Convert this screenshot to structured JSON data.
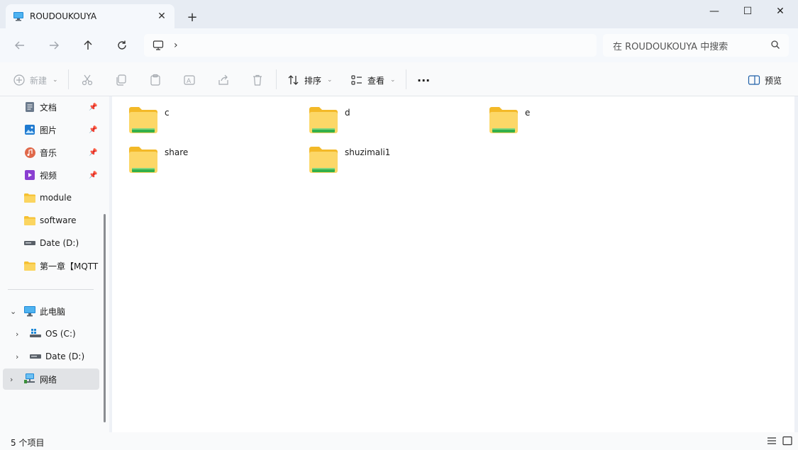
{
  "window": {
    "tab_title": "ROUDOUKOUYA",
    "tab_close": "✕",
    "new_tab": "+",
    "minimize": "—",
    "maximize": "☐",
    "close": "✕"
  },
  "nav": {
    "back_icon": "arrow-left-icon",
    "forward_icon": "arrow-right-icon",
    "up_icon": "arrow-up-icon",
    "refresh_icon": "refresh-icon",
    "address_chevron": "›",
    "search_placeholder": "在 ROUDOUKOUYA 中搜索"
  },
  "commands": {
    "new_label": "新建",
    "sort_label": "排序",
    "view_label": "查看",
    "more_label": "···",
    "preview_label": "预览"
  },
  "sidebar": {
    "quick_access": [
      {
        "label": "文档",
        "icon": "documents-icon",
        "pinned": true
      },
      {
        "label": "图片",
        "icon": "pictures-icon",
        "pinned": true
      },
      {
        "label": "音乐",
        "icon": "music-icon",
        "pinned": true
      },
      {
        "label": "视频",
        "icon": "videos-icon",
        "pinned": true
      },
      {
        "label": "module",
        "icon": "folder-icon",
        "pinned": false
      },
      {
        "label": "software",
        "icon": "folder-icon",
        "pinned": false
      },
      {
        "label": "Date (D:)",
        "icon": "drive-icon",
        "pinned": false
      },
      {
        "label": "第一章【MQTT",
        "icon": "folder-icon",
        "pinned": false
      }
    ],
    "this_pc": "此电脑",
    "drives": [
      {
        "label": "OS (C:)",
        "icon": "windows-drive-icon"
      },
      {
        "label": "Date (D:)",
        "icon": "drive-icon"
      }
    ],
    "network": "网络"
  },
  "content": {
    "items": [
      {
        "name": "c"
      },
      {
        "name": "d"
      },
      {
        "name": "e"
      },
      {
        "name": "share"
      },
      {
        "name": "shuzimali1"
      }
    ]
  },
  "status": {
    "count_text": "5 个项目"
  },
  "colors": {
    "folder_yellow": "#f8c940",
    "folder_front": "#fbd870",
    "share_green": "#33b04a",
    "accent_blue": "#1e88d6"
  }
}
